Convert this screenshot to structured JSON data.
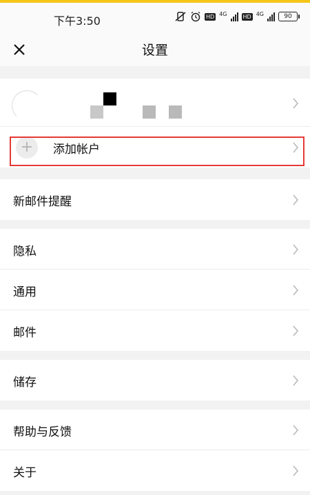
{
  "status_bar": {
    "time": "下午3:50",
    "net_1": "4G",
    "net_2": "4G",
    "hd_1": "HD",
    "hd_2": "HD",
    "battery": "90",
    "accent": "#f5c518"
  },
  "header": {
    "title": "设置",
    "close_icon": "close-icon"
  },
  "account": {
    "add_label": "添加帐户",
    "add_icon": "plus-icon"
  },
  "sections": {
    "new_mail": "新邮件提醒",
    "privacy": "隐私",
    "general": "通用",
    "mail": "邮件",
    "storage": "储存",
    "help": "帮助与反馈",
    "about": "关于"
  },
  "colors": {
    "highlight": "#e53935",
    "background": "#f2f2f2"
  }
}
